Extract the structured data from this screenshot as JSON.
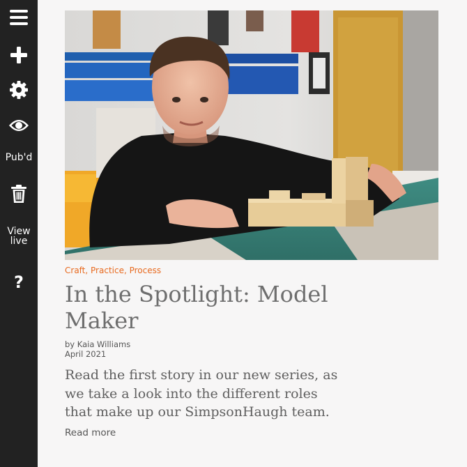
{
  "sidebar": {
    "items": [
      {
        "icon": "menu-icon"
      },
      {
        "icon": "plus-icon"
      },
      {
        "icon": "gear-icon"
      },
      {
        "icon": "eye-icon"
      },
      {
        "label": "Pub'd"
      },
      {
        "icon": "trash-icon"
      },
      {
        "label_line1": "View",
        "label_line2": "live"
      },
      {
        "icon": "help-icon",
        "label": "?"
      }
    ]
  },
  "post": {
    "categories": [
      "Craft",
      "Practice",
      "Process"
    ],
    "category_separator": ", ",
    "title": "In the Spotlight: Model Maker",
    "author": "by Kaia Williams",
    "date": "April 2021",
    "excerpt": "Read the first story in our new series, as we take a look into the different roles that make up our SimpsonHaugh team.",
    "read_more": "Read more"
  },
  "colors": {
    "sidebar_bg": "#222222",
    "accent": "#e86a1f",
    "title": "#6e6e6e",
    "page_bg": "#f7f6f6"
  }
}
